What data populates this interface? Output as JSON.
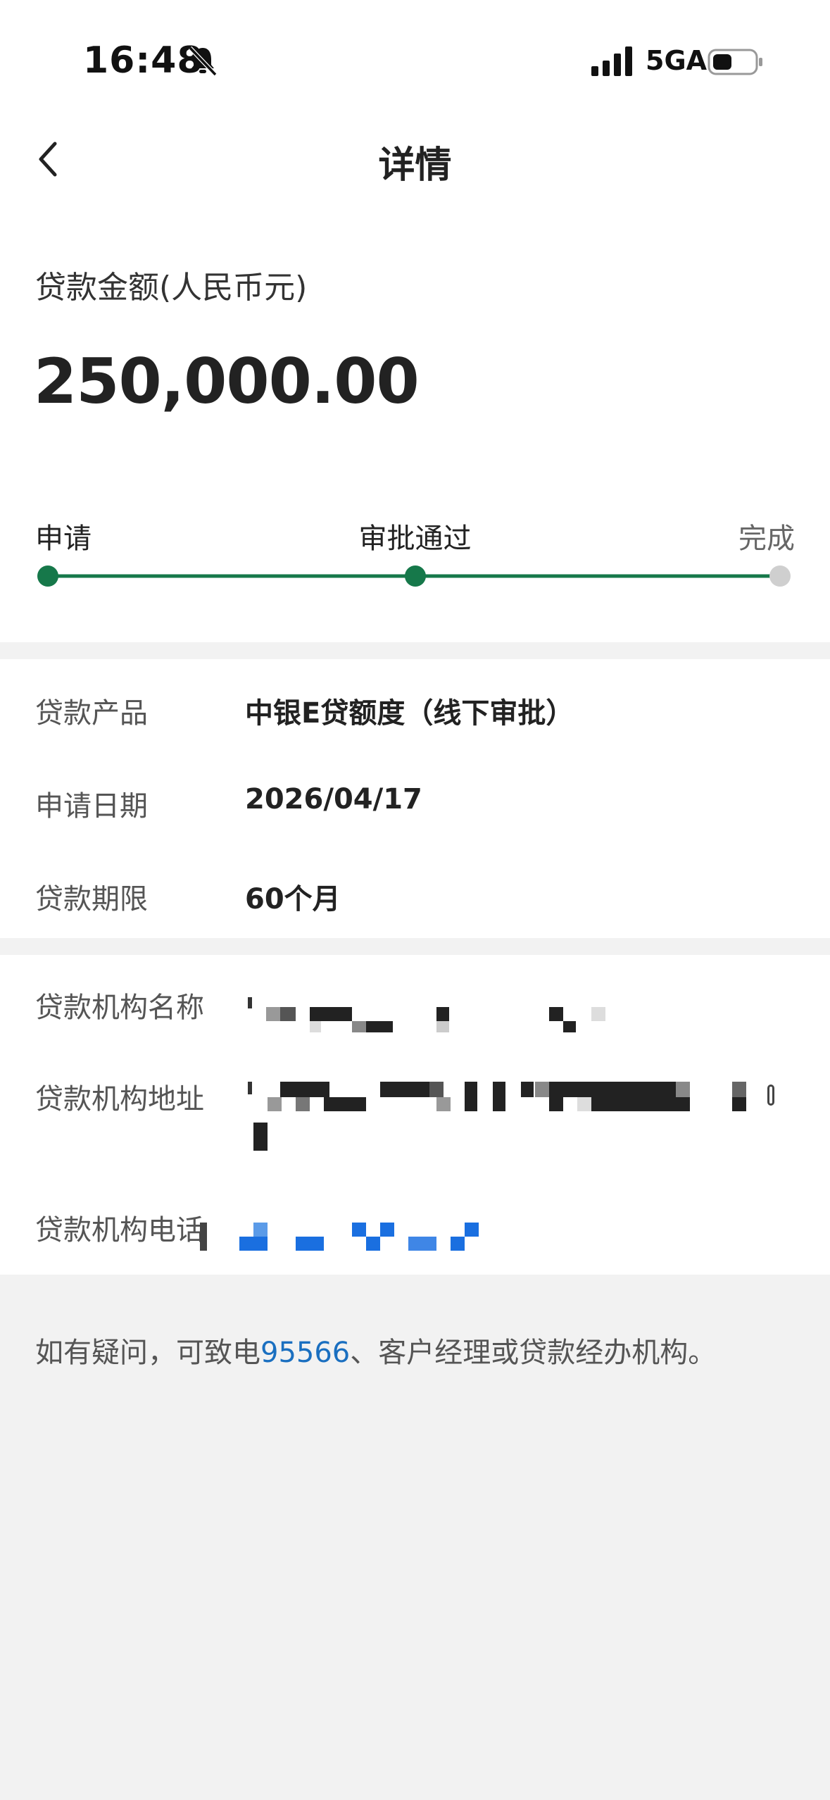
{
  "status_bar": {
    "time": "16:48",
    "network": "5GA"
  },
  "nav": {
    "title": "详情"
  },
  "amount": {
    "label": "贷款金额(人民币元)",
    "value": "250,000.00"
  },
  "progress": {
    "steps": [
      {
        "label": "申请",
        "done": true
      },
      {
        "label": "审批通过",
        "done": true
      },
      {
        "label": "完成",
        "done": false
      }
    ],
    "active_color": "#16784a",
    "inactive_color": "#cfcfcf"
  },
  "details": {
    "product_label": "贷款产品",
    "product_value": "中银E贷额度（线下审批）",
    "date_label": "申请日期",
    "date_value": "2026/04/17",
    "term_label": "贷款期限",
    "term_value": "60个月"
  },
  "institution": {
    "name_label": "贷款机构名称",
    "address_label": "贷款机构地址",
    "phone_label": "贷款机构电话"
  },
  "footer": {
    "prefix": "如有疑问，可致电",
    "hotline": "95566",
    "suffix": "、客户经理或贷款经办机构。"
  },
  "colors": {
    "link": "#1a6fc0",
    "page_bg": "#f2f2f2"
  }
}
